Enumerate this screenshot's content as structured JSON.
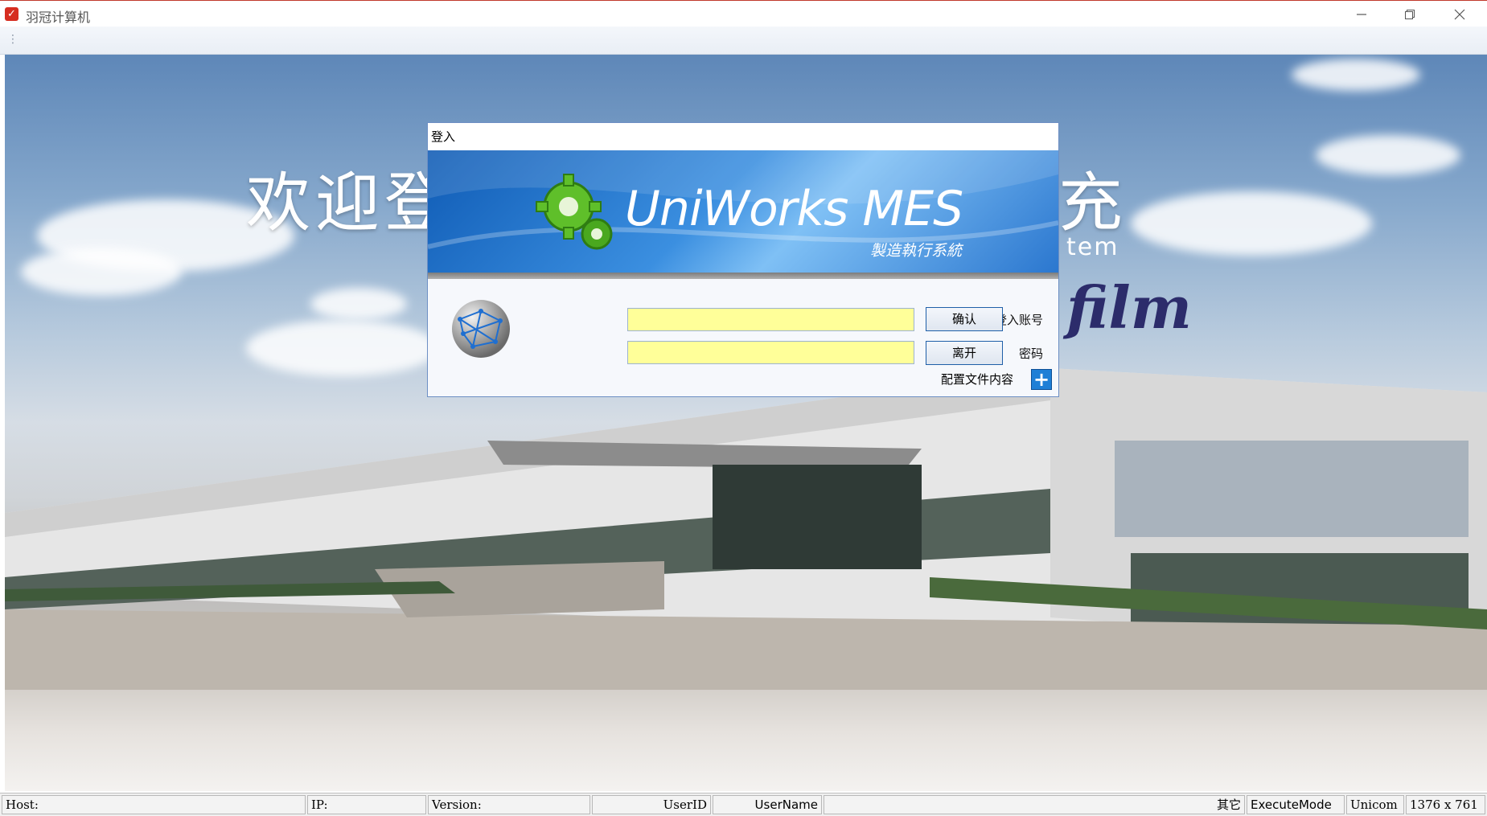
{
  "window": {
    "title": "羽冠计算机",
    "minimize_glyph": "—",
    "restore_glyph": "❐",
    "close_glyph": "✕"
  },
  "background": {
    "welcome_head": "欢迎登",
    "welcome_tail": "充",
    "system_tail": "tem",
    "company_text": "film"
  },
  "dialog": {
    "title": "登入",
    "brand": "UniWorks MES",
    "brand_sub": "製造執行系統",
    "account_label": "登入账号",
    "password_label": "密码",
    "account_value": "",
    "password_value": "",
    "confirm_label": "确认",
    "leave_label": "离开",
    "config_label": "配置文件内容"
  },
  "status": {
    "host": "Host:",
    "ip": "IP:",
    "version": "Version:",
    "userid": "UserID",
    "username": "UserName",
    "other": "其它",
    "execute_mode": "ExecuteMode",
    "unicom": "Unicom",
    "resolution": "1376 x 761"
  },
  "icons": {
    "app": "app-logo-icon",
    "globe": "globe-icon",
    "gear": "gear-icon",
    "plus": "plus-icon"
  }
}
